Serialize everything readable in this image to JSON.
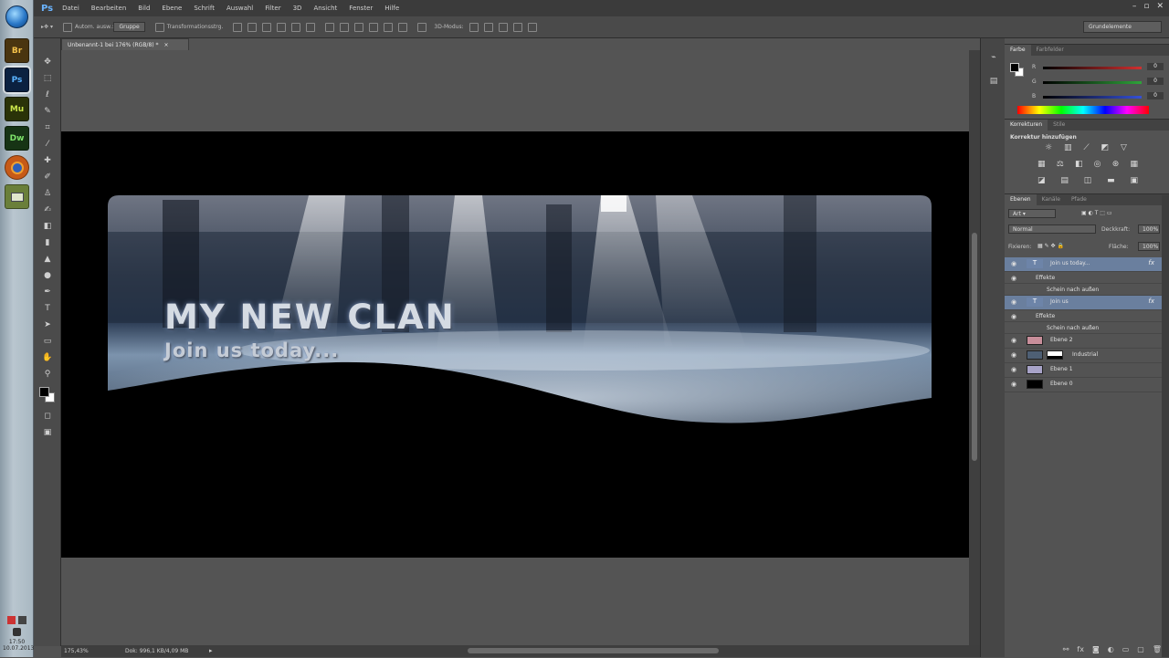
{
  "taskbar": {
    "apps": [
      {
        "label": "Br",
        "bg": "#4a3510",
        "fg": "#f5c24a"
      },
      {
        "label": "Ps",
        "bg": "#0b2140",
        "fg": "#5ab3ff"
      },
      {
        "label": "Mu",
        "bg": "#2a3308",
        "fg": "#c9e54a"
      },
      {
        "label": "Dw",
        "bg": "#173415",
        "fg": "#7ee36a"
      },
      {
        "label": "",
        "bg": "#c65a18",
        "fg": "#ffd27a",
        "icon": "firefox-icon"
      },
      {
        "label": "",
        "bg": "#6a7f3a",
        "fg": "#e8ecd6",
        "icon": "app-icon"
      }
    ],
    "active_app": "Ps",
    "time": "17:50",
    "date": "10.07.2013"
  },
  "menu": {
    "logo": "Ps",
    "items": [
      "Datei",
      "Bearbeiten",
      "Bild",
      "Ebene",
      "Schrift",
      "Auswahl",
      "Filter",
      "3D",
      "Ansicht",
      "Fenster",
      "Hilfe"
    ]
  },
  "options": {
    "auto_select": "Autom. ausw.:",
    "group": "Gruppe",
    "transform": "Transformationsstrg.",
    "mode3d": "3D-Modus:",
    "workspace": "Grundelemente"
  },
  "document": {
    "tab_title": "Unbenannt-1 bei 176% (RGB/8) *",
    "banner_title": "MY NEW CLAN",
    "banner_subtitle": "Join us today..."
  },
  "status": {
    "zoom": "175,43%",
    "docinfo": "Dok: 996,1 KB/4,09 MB"
  },
  "color_panel": {
    "tabs": [
      "Farbe",
      "Farbfelder"
    ],
    "channels": [
      {
        "label": "R",
        "value": "0",
        "track": "#d13030"
      },
      {
        "label": "G",
        "value": "0",
        "track": "#2ea43a"
      },
      {
        "label": "B",
        "value": "0",
        "track": "#3550d8"
      }
    ]
  },
  "adjust_panel": {
    "tabs": [
      "Korrekturen",
      "Stile"
    ],
    "title": "Korrektur hinzufügen"
  },
  "layers_panel": {
    "tabs": [
      "Ebenen",
      "Kanäle",
      "Pfade"
    ],
    "filter": "Art",
    "blend_mode": "Normal",
    "opacity_label": "Deckkraft:",
    "opacity": "100%",
    "lock_label": "Fixieren:",
    "fill_label": "Fläche:",
    "fill": "100%",
    "layers": [
      {
        "kind": "text",
        "name": "Join us today...",
        "selected": true,
        "fx": true
      },
      {
        "kind": "sub",
        "name": "Effekte"
      },
      {
        "kind": "sub2",
        "name": "Schein nach außen"
      },
      {
        "kind": "text",
        "name": "Join us",
        "selected": true,
        "fx": true
      },
      {
        "kind": "sub",
        "name": "Effekte"
      },
      {
        "kind": "sub2",
        "name": "Schein nach außen"
      },
      {
        "kind": "pixel",
        "name": "Ebene 2",
        "thumb": "#c88e9a"
      },
      {
        "kind": "masked",
        "name": "Industrial",
        "thumb": "#4e5f74"
      },
      {
        "kind": "pixel",
        "name": "Ebene 1",
        "thumb": "#a8a3c8"
      },
      {
        "kind": "pixel",
        "name": "Ebene 0",
        "thumb": "#000000"
      }
    ]
  }
}
